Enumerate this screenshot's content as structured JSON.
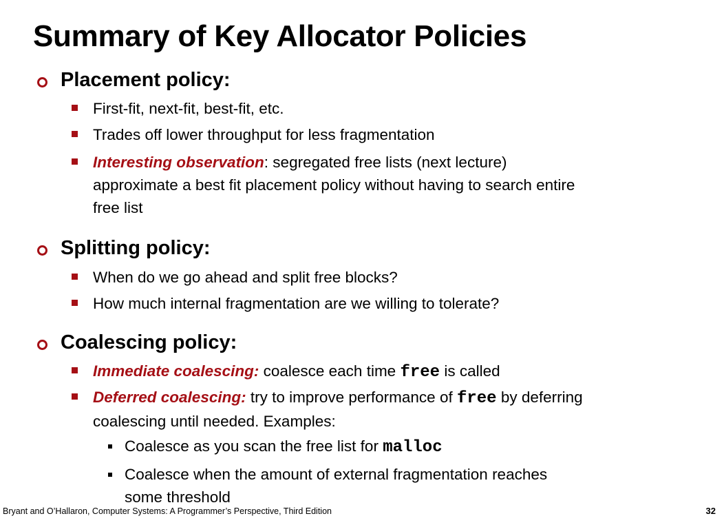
{
  "title": "Summary of Key Allocator Policies",
  "placement": {
    "heading": "Placement policy:",
    "items": [
      "First-fit, next-fit, best-fit, etc.",
      "Trades off lower throughput for less fragmentation"
    ],
    "observation_label": "Interesting observation",
    "observation_line1": ": segregated free lists (next lecture)",
    "observation_line2": "approximate a best fit placement policy without having to search entire",
    "observation_line3": "free list"
  },
  "splitting": {
    "heading": "Splitting policy:",
    "items": [
      "When do we go ahead and split free blocks?",
      "How much internal fragmentation are we willing to tolerate?"
    ]
  },
  "coalescing": {
    "heading": "Coalescing policy:",
    "immediate_label": "Immediate coalescing:",
    "immediate_text_before": " coalesce each time ",
    "immediate_code": "free",
    "immediate_text_after": " is called",
    "deferred_label": "Deferred coalescing:",
    "deferred_text_before": " try to improve performance of ",
    "deferred_code": "free",
    "deferred_text_after": " by deferring",
    "deferred_line2": "coalescing until needed. Examples:",
    "example1_text": "Coalesce as you scan the free list for ",
    "example1_code": "malloc",
    "example2_line1": "Coalesce when the amount of external fragmentation reaches",
    "example2_line2": "some threshold"
  },
  "footer": {
    "citation": "Bryant and O’Hallaron, Computer Systems: A Programmer’s Perspective, Third Edition",
    "page_number": "32"
  },
  "colors": {
    "accent": "#a50f15"
  }
}
